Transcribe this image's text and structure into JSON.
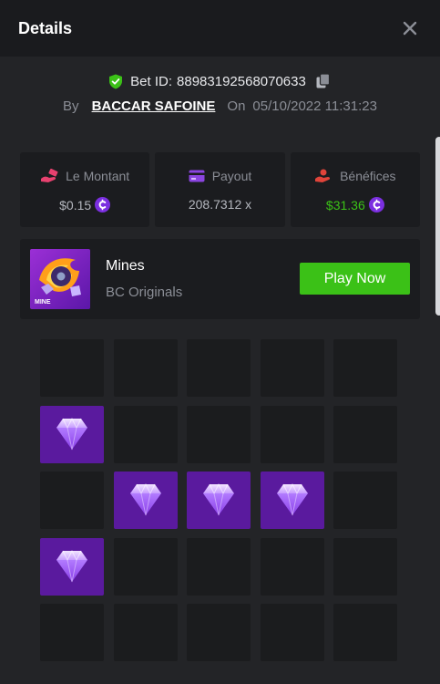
{
  "header": {
    "title": "Details",
    "close_icon": "close-icon"
  },
  "bet": {
    "id_label": "Bet ID:",
    "id_value": "88983192568070633",
    "by_label": "By",
    "username": "BACCAR SAFOINE",
    "on_label": "On",
    "datetime": "05/10/2022 11:31:23",
    "icons": {
      "verified": "shield-check-icon",
      "copy": "copy-icon"
    }
  },
  "stats": [
    {
      "label": "Le Montant",
      "value": "$0.15",
      "icon": "money-hand-icon",
      "value_color": "#b4b7be",
      "coin": true
    },
    {
      "label": "Payout",
      "value": "208.7312 x",
      "icon": "card-icon",
      "value_color": "#b4b7be",
      "coin": false
    },
    {
      "label": "Bénéfices",
      "value": "$31.36",
      "icon": "profit-hand-icon",
      "value_color": "#3bc117",
      "coin": true
    }
  ],
  "game": {
    "name": "Mines",
    "provider": "BC Originals",
    "thumb_label": "MINE",
    "play_label": "Play Now"
  },
  "grid": {
    "rows": 5,
    "cols": 5,
    "gem_cells": [
      [
        1,
        0
      ],
      [
        2,
        1
      ],
      [
        2,
        2
      ],
      [
        2,
        3
      ],
      [
        3,
        0
      ]
    ]
  },
  "colors": {
    "accent_green": "#3bc117",
    "gem_tile": "#5a1a9e",
    "coin_purple": "#7b2fe0",
    "pink_icon": "#e8416f",
    "purple_icon": "#8b45e0",
    "red_icon": "#e0443a"
  }
}
